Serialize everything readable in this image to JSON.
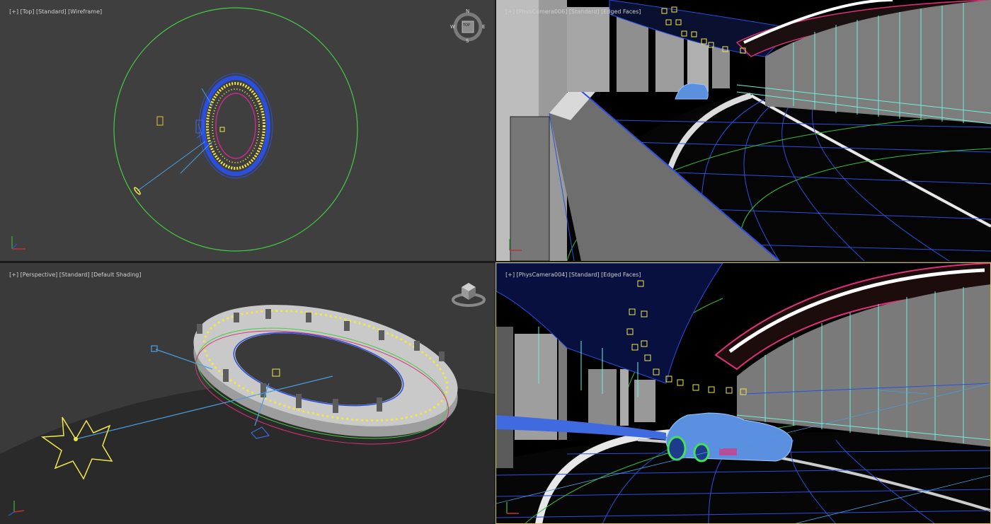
{
  "viewports": [
    {
      "id": "top",
      "menu": "[+]",
      "view": "[Top]",
      "shading_style": "[Standard]",
      "shading": "[Wireframe]",
      "background": "#3f3f3f"
    },
    {
      "id": "physcam006",
      "menu": "[+]",
      "view": "[PhysCamera006]",
      "shading_style": "[Standard]",
      "shading": "[Edged Faces]",
      "background": "#000000"
    },
    {
      "id": "perspective",
      "menu": "[+]",
      "view": "[Perspective]",
      "shading_style": "[Standard]",
      "shading": "[Default Shading]",
      "background": "#3a3a3a"
    },
    {
      "id": "physcam004",
      "menu": "[+]",
      "view": "[PhysCamera004]",
      "shading_style": "[Standard]",
      "shading": "[Edged Faces]",
      "background": "#000000",
      "active": true
    }
  ],
  "viewcube": {
    "top_face": "TOP",
    "compass": {
      "n": "N",
      "s": "S",
      "e": "E",
      "w": "W"
    }
  },
  "colors": {
    "wire_green": "#44cc44",
    "wire_blue": "#2a4fe0",
    "wire_yellow": "#f2e64a",
    "cyan": "#6ff0d8",
    "magenta": "#e0307a",
    "car_blue": "#5b8fe0",
    "active_border": "#d6c95a"
  }
}
